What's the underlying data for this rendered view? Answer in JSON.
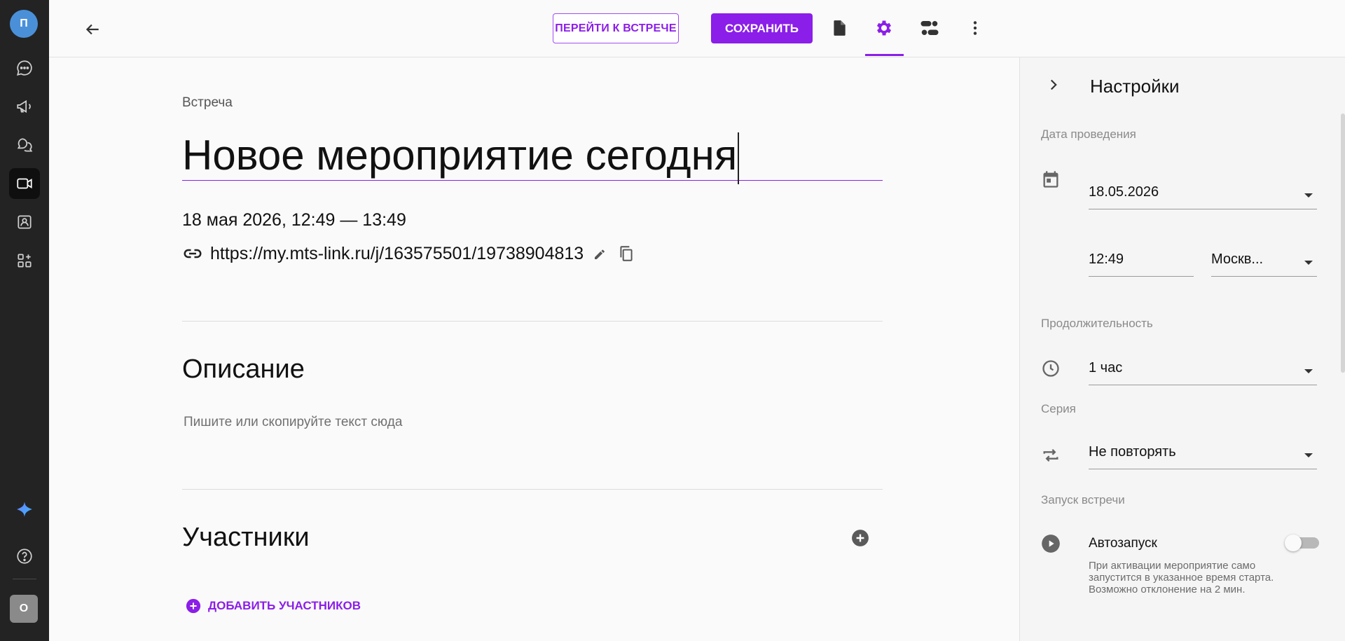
{
  "rail": {
    "avatar_initial": "П",
    "user_initial": "О",
    "items": [
      {
        "name": "chat-icon"
      },
      {
        "name": "megaphone-icon"
      },
      {
        "name": "messages-icon"
      },
      {
        "name": "video-icon"
      },
      {
        "name": "contact-card-icon"
      },
      {
        "name": "apps-icon"
      }
    ]
  },
  "toolbar": {
    "go_to_meeting": "ПЕРЕЙТИ К ВСТРЕЧЕ",
    "save": "СОХРАНИТЬ"
  },
  "event": {
    "type_label": "Встреча",
    "title": "Новое мероприятие сегодня",
    "datetime": "18 мая 2026, 12:49 — 13:49",
    "link": "https://my.mts-link.ru/j/163575501/19738904813"
  },
  "description": {
    "title": "Описание",
    "placeholder": "Пишите или скопируйте текст сюда"
  },
  "participants": {
    "title": "Участники",
    "add_label": "ДОБАВИТЬ УЧАСТНИКОВ"
  },
  "settings": {
    "title": "Настройки",
    "date_label": "Дата проведения",
    "date_value": "18.05.2026",
    "time_value": "12:49",
    "timezone_value": "Москв...",
    "duration_label": "Продолжительность",
    "duration_value": "1 час",
    "series_label": "Серия",
    "series_value": "Не повторять",
    "launch_label": "Запуск встречи",
    "autostart_label": "Автозапуск",
    "autostart_on": false,
    "autostart_help": "При активации мероприятие само запустится в указанное время старта. Возможно отклонение на 2 мин."
  },
  "colors": {
    "accent": "#8b1ee8",
    "rail_bg": "#232323"
  }
}
